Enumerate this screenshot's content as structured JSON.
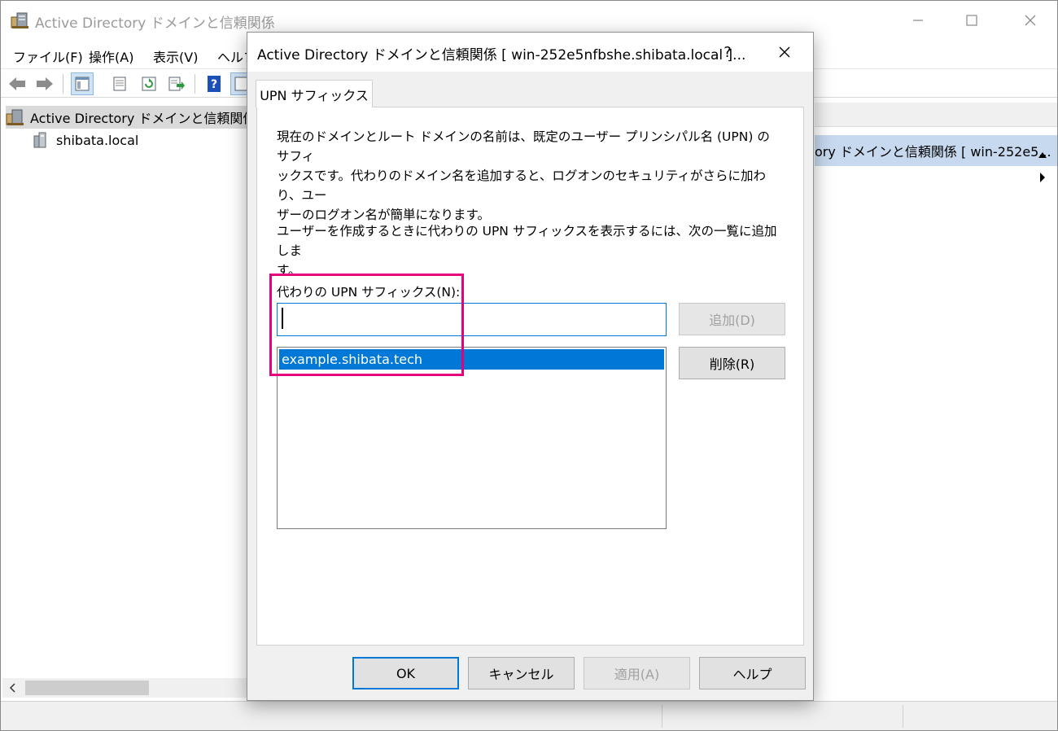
{
  "app": {
    "title": "Active Directory ドメインと信頼関係"
  },
  "menu": [
    "ファイル(F)",
    "操作(A)",
    "表示(V)",
    "ヘルプ"
  ],
  "tree": {
    "root_label": "Active Directory ドメインと信頼関係",
    "child_label": "shibata.local"
  },
  "right_pane": {
    "actions_header": "ory ドメインと信頼関係 [ win-252e5..."
  },
  "dialog": {
    "title": "Active Directory ドメインと信頼関係 [ win-252e5nfbshe.shibata.local ]...",
    "help_glyph": "?",
    "tab_label": "UPN サフィックス",
    "para1_line1": "現在のドメインとルート ドメインの名前は、既定のユーザー プリンシパル名 (UPN) のサフィ",
    "para1_line2": "ックスです。代わりのドメイン名を追加すると、ログオンのセキュリティがさらに加わり、ユー",
    "para1_line3": "ザーのログオン名が簡単になります。",
    "para2_line1": "ユーザーを作成するときに代わりの UPN サフィックスを表示するには、次の一覧に追加しま",
    "para2_line2": "す。",
    "field_label": "代わりの UPN サフィックス(N):",
    "input_value": "",
    "list_items": [
      "example.shibata.tech"
    ],
    "add_button": "追加(D)",
    "remove_button": "削除(R)",
    "ok_button": "OK",
    "cancel_button": "キャンセル",
    "apply_button": "適用(A)",
    "help_button": "ヘルプ"
  },
  "colors": {
    "selection": "#0078d7",
    "highlight_box": "#e6007e",
    "actions_header_bg": "#c7d9ef"
  },
  "icons": [
    "app-ad-icon",
    "minimize-icon",
    "maximize-icon",
    "close-icon",
    "back-arrow-icon",
    "forward-arrow-icon",
    "console-tree-icon",
    "properties-icon",
    "refresh-icon",
    "export-list-icon",
    "help-icon",
    "domain-icon",
    "expand-up-icon",
    "more-actions-icon",
    "scroll-left-icon"
  ]
}
